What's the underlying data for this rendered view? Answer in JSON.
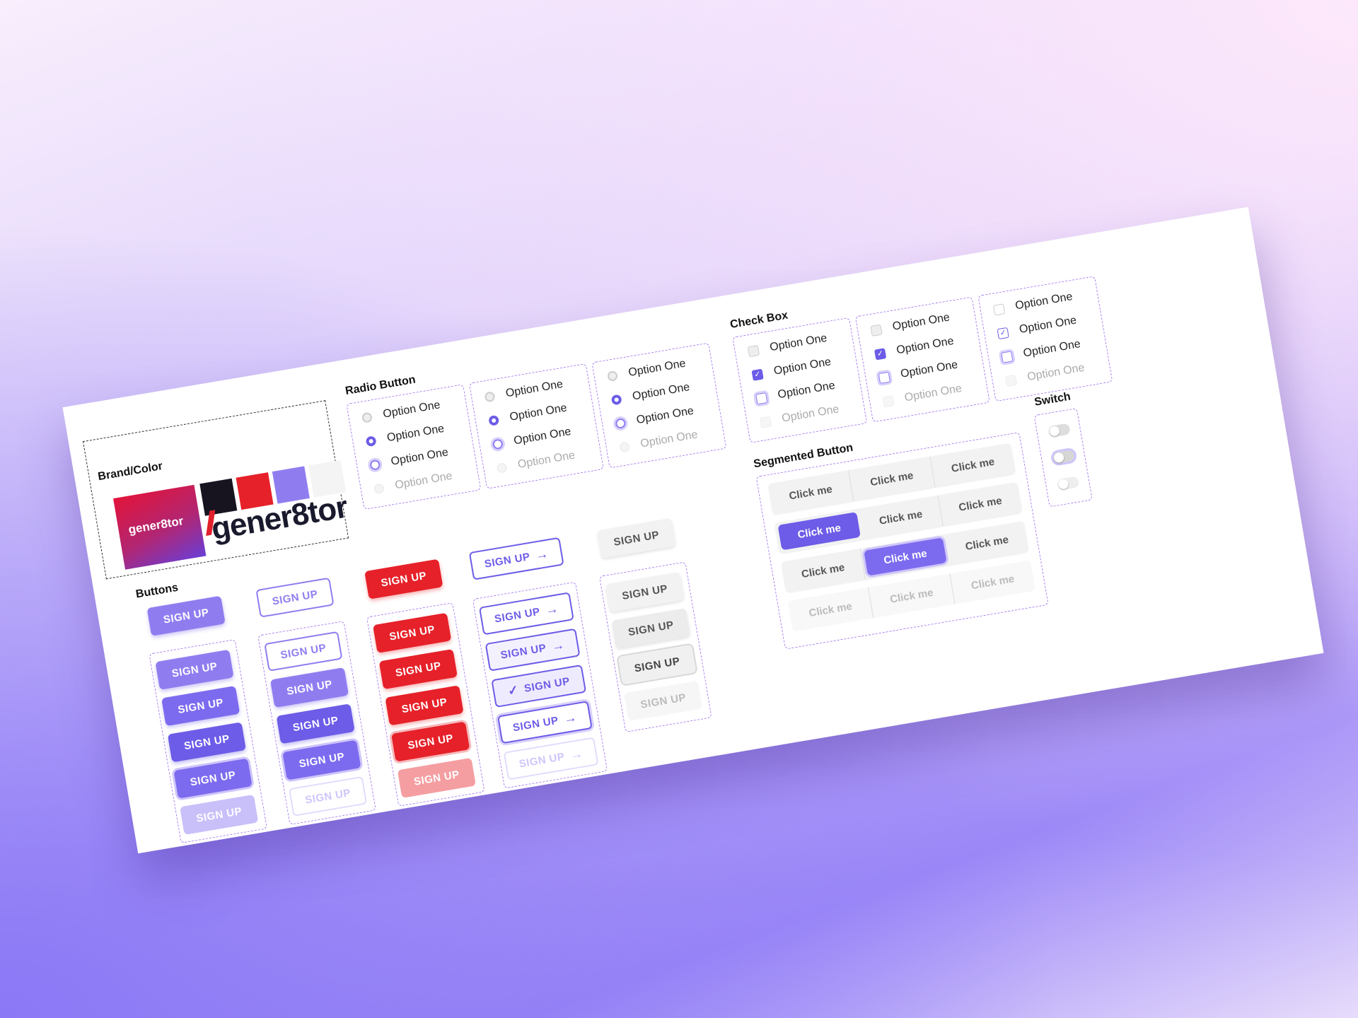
{
  "colors": {
    "black": "#17141f",
    "red": "#e62129",
    "purple": "#8f7df0",
    "light": "#f4f4f4"
  },
  "brand": {
    "title": "Brand/Color",
    "tile_text": "gener8tor",
    "wordmark": "gener8tor"
  },
  "radio": {
    "title": "Radio Button",
    "option": "Option One",
    "states": [
      "default",
      "selected",
      "focused",
      "disabled"
    ]
  },
  "checkbox": {
    "title": "Check Box",
    "option": "Option One",
    "check_glyph": "✓"
  },
  "buttons": {
    "title": "Buttons",
    "label": "SIGN UP",
    "arrow": "→",
    "check": "✓"
  },
  "segmented": {
    "title": "Segmented Button",
    "cell": "Click me",
    "rows": [
      [
        "Click me",
        "Click me",
        "Click me"
      ],
      [
        "Click me",
        "Click me",
        "Click me"
      ],
      [
        "Click me",
        "Click me",
        "Click me"
      ],
      [
        "Click me",
        "Click me",
        "Click me"
      ]
    ]
  },
  "switch": {
    "title": "Switch"
  }
}
